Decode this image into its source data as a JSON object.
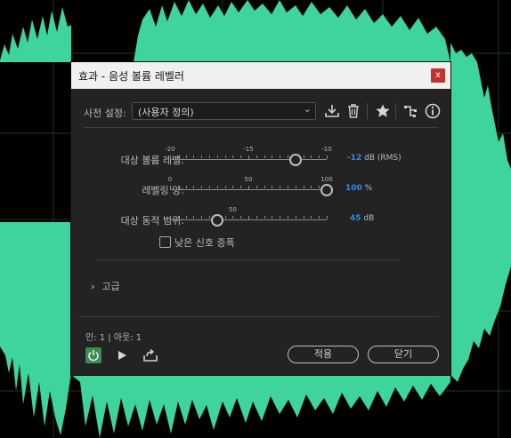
{
  "dialog": {
    "title": "효과 - 음성 볼륨 레벨러",
    "close_glyph": "x",
    "preset_label": "사전 설정:",
    "preset_value": "(사용자 정의)",
    "toolbar_icons": [
      "download-icon",
      "trash-icon",
      "star-icon",
      "routing-icon",
      "info-icon"
    ]
  },
  "controls": [
    {
      "label": "대상 볼륨 레벨:",
      "ticks": [
        "-20",
        "-15",
        "-10"
      ],
      "value": "-12",
      "unit": "dB (RMS)",
      "fraction": 0.8
    },
    {
      "label": "레벨링 양:",
      "ticks": [
        "0",
        "50",
        "100"
      ],
      "value": "100",
      "unit": "%",
      "fraction": 1.0
    },
    {
      "label": "대상 동적 범위:",
      "ticks": [
        "50"
      ],
      "value": "45",
      "unit": "dB",
      "fraction": 0.3
    }
  ],
  "checkbox": {
    "label": "낮은 신호 증폭",
    "checked": false
  },
  "advanced": {
    "label": "고급"
  },
  "footer": {
    "io_text": "인: 1 | 아웃: 1",
    "apply_label": "적용",
    "close_label": "닫기"
  },
  "colors": {
    "waveform": "#3fd49b",
    "accent_value": "#2f8ae8",
    "power_active": "#3c8b52"
  }
}
